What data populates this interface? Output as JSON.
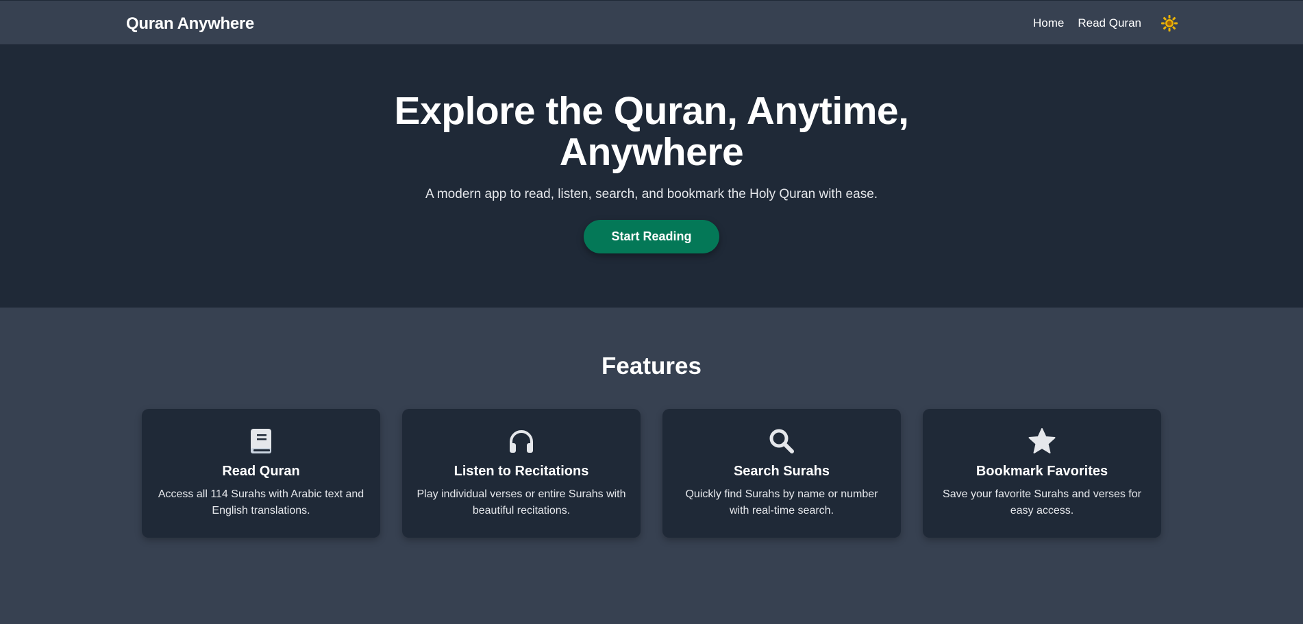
{
  "nav": {
    "brand": "Quran Anywhere",
    "links": [
      "Home",
      "Read Quran"
    ],
    "theme_icon": "sun-icon",
    "theme_color": "#eab308"
  },
  "hero": {
    "title": "Explore the Quran, Anytime, Anywhere",
    "subtitle": "A modern app to read, listen, search, and bookmark the Holy Quran with ease.",
    "cta": "Start Reading"
  },
  "features": {
    "title": "Features",
    "items": [
      {
        "icon": "book-icon",
        "title": "Read Quran",
        "desc": "Access all 114 Surahs with Arabic text and English translations."
      },
      {
        "icon": "headphones-icon",
        "title": "Listen to Recitations",
        "desc": "Play individual verses or entire Surahs with beautiful recitations."
      },
      {
        "icon": "search-icon",
        "title": "Search Surahs",
        "desc": "Quickly find Surahs by name or number with real-time search."
      },
      {
        "icon": "star-icon",
        "title": "Bookmark Favorites",
        "desc": "Save your favorite Surahs and verses for easy access."
      }
    ]
  },
  "colors": {
    "nav_bg": "#374151",
    "hero_bg": "#1f2937",
    "accent": "#047857",
    "card_bg": "#1f2937"
  }
}
